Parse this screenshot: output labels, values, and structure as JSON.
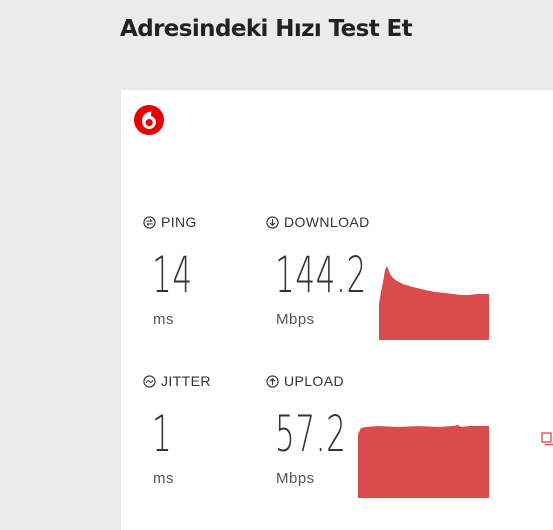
{
  "header": {
    "title": "Adresindeki Hızı Test Et"
  },
  "brand": {
    "logo_icon": "vodafone-logo-icon",
    "color": "#e60000"
  },
  "metrics": {
    "ping": {
      "icon": "ping-icon",
      "label": "PING",
      "value": "14",
      "unit": "ms"
    },
    "download": {
      "icon": "download-arrow-icon",
      "label": "DOWNLOAD",
      "value": "144.2",
      "unit": "Mbps"
    },
    "jitter": {
      "icon": "jitter-icon",
      "label": "JITTER",
      "value": "1",
      "unit": "ms"
    },
    "upload": {
      "icon": "upload-arrow-icon",
      "label": "UPLOAD",
      "value": "57.2",
      "unit": "Mbps"
    }
  },
  "graph_color": "#d94b4d",
  "edge_icon": "copy-icon"
}
